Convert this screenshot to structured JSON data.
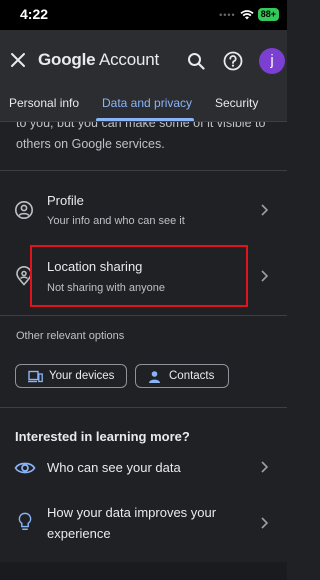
{
  "status_bar": {
    "time": "4:22",
    "battery": "88+"
  },
  "app_bar": {
    "logo_brand": "Google",
    "logo_product": "Account",
    "avatar_letter": "j"
  },
  "tabs": [
    {
      "label": "Personal info",
      "active": false
    },
    {
      "label": "Data and privacy",
      "active": true
    },
    {
      "label": "Security",
      "active": false
    }
  ],
  "intro_text": "to you, but you can make some of it visible to others on Google services.",
  "rows": {
    "profile": {
      "title": "Profile",
      "subtitle": "Your info and who can see it"
    },
    "location": {
      "title": "Location sharing",
      "subtitle": "Not sharing with anyone"
    }
  },
  "other_options": {
    "label": "Other relevant options",
    "devices": "Your devices",
    "contacts": "Contacts"
  },
  "learn_more": {
    "title": "Interested in learning more?",
    "items": [
      {
        "label": "Who can see your data"
      },
      {
        "label_line1": "How your data improves your",
        "label_line2": "experience"
      }
    ]
  },
  "colors": {
    "accent": "#8ab4f8",
    "avatar": "#7b3fd1",
    "highlight": "#e0141c",
    "background": "#202124"
  },
  "icons": [
    "close-icon",
    "search-icon",
    "help-icon",
    "person-icon",
    "location-person-icon",
    "devices-icon",
    "contacts-icon",
    "eye-icon",
    "lightbulb-icon",
    "chevron-right-icon",
    "wifi-icon"
  ]
}
